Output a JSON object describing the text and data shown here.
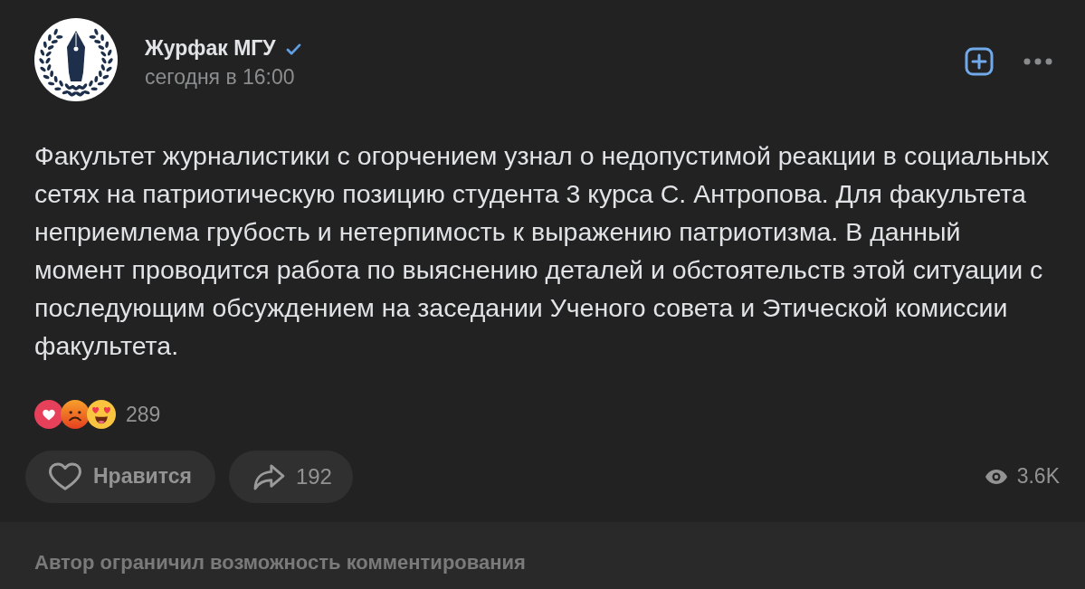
{
  "post": {
    "author": {
      "name": "Журфак МГУ",
      "verified": true
    },
    "time": "сегодня в 16:00",
    "text": "Факультет журналистики с огорчением узнал о недопустимой реакции в социальных сетях на патриотическую позицию студента 3 курса С. Антропова. Для факультета неприемлема грубость и нетерпимость к выражению патриотизма. В данный момент проводится работа по выяснению деталей и обстоятельств этой ситуации с последующим обсуждением на заседании Ученого совета и Этической комиссии факультета.",
    "reactions": {
      "emojis": [
        {
          "kind": "heart"
        },
        {
          "kind": "sad"
        },
        {
          "kind": "love"
        }
      ],
      "count": "289"
    },
    "like_button": {
      "label": "Нравится",
      "liked": false
    },
    "share_button": {
      "count": "192"
    },
    "views": "3.6K"
  },
  "footer": {
    "notice": "Автор ограничил возможность комментирования"
  }
}
